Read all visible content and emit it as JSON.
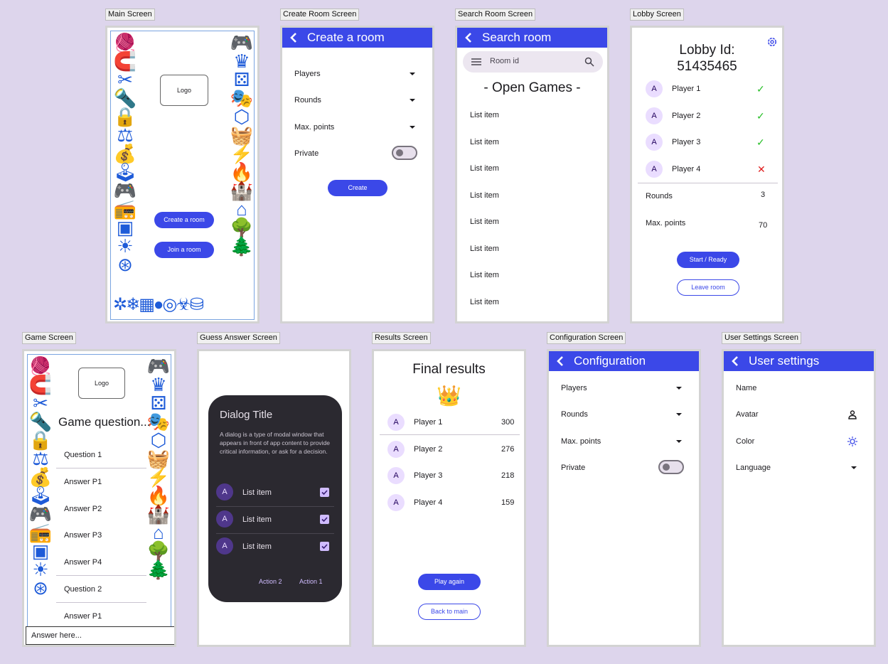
{
  "labels": {
    "main": "Main Screen",
    "create": "Create Room Screen",
    "search": "Search Room Screen",
    "lobby": "Lobby Screen",
    "game": "Game Screen",
    "guess": "Guess Answer Screen",
    "results": "Results Screen",
    "config": "Configuration Screen",
    "user": "User Settings Screen"
  },
  "main": {
    "logo": "Logo",
    "create_btn": "Create a room",
    "join_btn": "Join a room"
  },
  "create": {
    "title": "Create a room",
    "players": "Players",
    "rounds": "Rounds",
    "max_points": "Max. points",
    "private": "Private",
    "create_btn": "Create"
  },
  "search": {
    "title": "Search room",
    "placeholder": "Room id",
    "heading": "- Open Games -",
    "items": [
      "List item",
      "List item",
      "List item",
      "List item",
      "List item",
      "List item",
      "List item",
      "List item"
    ]
  },
  "lobby": {
    "title_line1": "Lobby Id:",
    "title_line2": "51435465",
    "players": [
      {
        "avatar": "A",
        "name": "Player 1",
        "status": "✓"
      },
      {
        "avatar": "A",
        "name": "Player 2",
        "status": "✓"
      },
      {
        "avatar": "A",
        "name": "Player 3",
        "status": "✓"
      },
      {
        "avatar": "A",
        "name": "Player 4",
        "status": "✕"
      }
    ],
    "rounds_label": "Rounds",
    "rounds_value": "3",
    "max_points_label": "Max. points",
    "max_points_value": "70",
    "start_btn": "Start / Ready",
    "leave_btn": "Leave room"
  },
  "game": {
    "logo": "Logo",
    "question_title": "Game question...",
    "lines": [
      "Question 1",
      "Answer P1",
      "Answer P2",
      "Answer P3",
      "Answer P4",
      "Question 2",
      "Answer P1"
    ],
    "answer_placeholder": "Answer here..."
  },
  "guess": {
    "dialog_title": "Dialog Title",
    "dialog_text": "A dialog is a type of modal window that appears in front of app content to provide critical information, or ask for a decision.",
    "items": [
      {
        "avatar": "A",
        "label": "List item"
      },
      {
        "avatar": "A",
        "label": "List item"
      },
      {
        "avatar": "A",
        "label": "List item"
      }
    ],
    "action2": "Action 2",
    "action1": "Action 1"
  },
  "results": {
    "title": "Final results",
    "crown": "👑",
    "rows": [
      {
        "avatar": "A",
        "name": "Player 1",
        "score": "300"
      },
      {
        "avatar": "A",
        "name": "Player 2",
        "score": "276"
      },
      {
        "avatar": "A",
        "name": "Player 3",
        "score": "218"
      },
      {
        "avatar": "A",
        "name": "Player 4",
        "score": "159"
      }
    ],
    "play_again": "Play again",
    "back_main": "Back to main"
  },
  "config": {
    "title": "Configuration",
    "players": "Players",
    "rounds": "Rounds",
    "max_points": "Max. points",
    "private": "Private"
  },
  "user": {
    "title": "User settings",
    "name": "Name",
    "avatar": "Avatar",
    "color": "Color",
    "language": "Language"
  },
  "colors": {
    "primary": "#3b48e8",
    "background": "#ddd5ec",
    "dialog": "#2b2930",
    "check_ok": "#2bc02b",
    "check_bad": "#e02020"
  },
  "icons": {
    "border_left": [
      "yarn-icon",
      "magnet-icon",
      "scissors-icon",
      "flashlight-icon",
      "lock-icon",
      "scales-icon",
      "money-bag-icon",
      "joystick-icon",
      "gamepad-icon",
      "walkie-talkie-icon",
      "chip-icon",
      "sun-icon",
      "wheel-icon"
    ],
    "border_right": [
      "controller-icon",
      "crown-icon",
      "dice-icon",
      "theater-mask-icon",
      "cube-icon",
      "basket-icon",
      "lightning-icon",
      "fire-icon",
      "castle-icon",
      "house-icon",
      "tree-icon",
      "bush-icon",
      "database-icon"
    ]
  }
}
